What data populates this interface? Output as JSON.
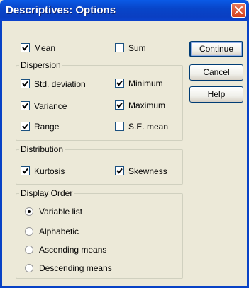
{
  "window": {
    "title": "Descriptives: Options"
  },
  "top": {
    "mean": {
      "label": "Mean",
      "checked": true
    },
    "sum": {
      "label": "Sum",
      "checked": false
    }
  },
  "dispersion": {
    "legend": "Dispersion",
    "items": [
      {
        "label": "Std. deviation",
        "checked": true
      },
      {
        "label": "Minimum",
        "checked": true
      },
      {
        "label": "Variance",
        "checked": true
      },
      {
        "label": "Maximum",
        "checked": true
      },
      {
        "label": "Range",
        "checked": true
      },
      {
        "label": "S.E. mean",
        "checked": false
      }
    ]
  },
  "distribution": {
    "legend": "Distribution",
    "items": [
      {
        "label": "Kurtosis",
        "checked": true
      },
      {
        "label": "Skewness",
        "checked": true
      }
    ]
  },
  "display_order": {
    "legend": "Display Order",
    "options": [
      {
        "label": "Variable list",
        "selected": true
      },
      {
        "label": "Alphabetic",
        "selected": false
      },
      {
        "label": "Ascending means",
        "selected": false
      },
      {
        "label": "Descending means",
        "selected": false
      }
    ]
  },
  "buttons": {
    "continue": "Continue",
    "cancel": "Cancel",
    "help": "Help"
  }
}
